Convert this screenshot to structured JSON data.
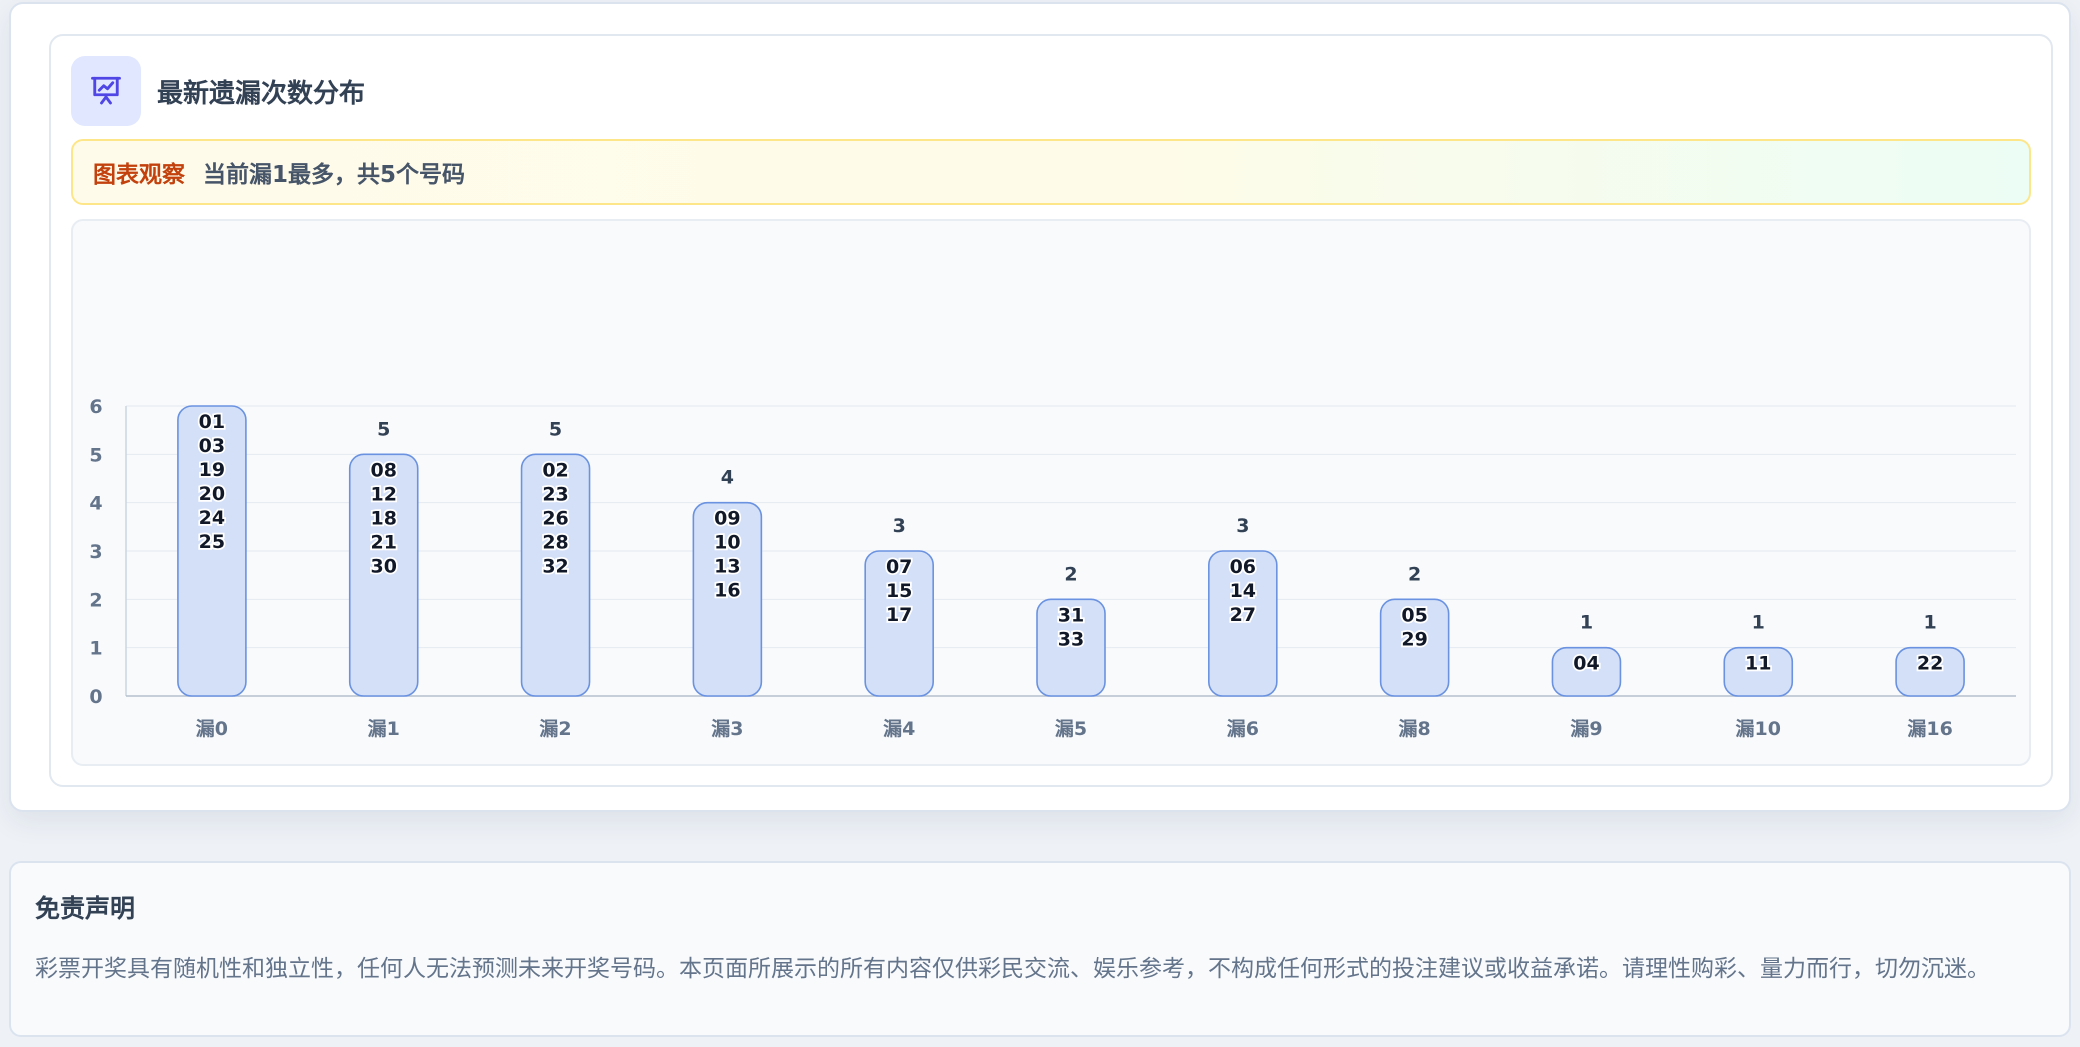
{
  "page": {
    "title": "最新遗漏次数分布",
    "title_icon": "presentation-chart-icon",
    "insight_tag": "图表观察",
    "insight_text": "当前漏1最多，共5个号码"
  },
  "disclaimer": {
    "title": "免责声明",
    "body": "彩票开奖具有随机性和独立性，任何人无法预测未来开奖号码。本页面所展示的所有内容仅供彩民交流、娱乐参考，不构成任何形式的投注建议或收益承诺。请理性购彩、量力而行，切勿沉迷。"
  },
  "colors": {
    "accent": "#4f46e5",
    "bar_fill": "#d3e0f8",
    "bar_stroke": "#6a92e0",
    "insight_tag": "#c2410c"
  },
  "chart_data": {
    "type": "bar",
    "categories": [
      "漏0",
      "漏1",
      "漏2",
      "漏3",
      "漏4",
      "漏5",
      "漏6",
      "漏8",
      "漏9",
      "漏10",
      "漏16"
    ],
    "values": [
      6,
      5,
      5,
      4,
      3,
      2,
      3,
      2,
      1,
      1,
      1
    ],
    "value_labels": [
      "",
      "5",
      "5",
      "4",
      "3",
      "2",
      "3",
      "2",
      "1",
      "1",
      "1"
    ],
    "numbers": [
      [
        "01",
        "03",
        "19",
        "20",
        "24",
        "25"
      ],
      [
        "08",
        "12",
        "18",
        "21",
        "30"
      ],
      [
        "02",
        "23",
        "26",
        "28",
        "32"
      ],
      [
        "09",
        "10",
        "13",
        "16"
      ],
      [
        "07",
        "15",
        "17"
      ],
      [
        "31",
        "33"
      ],
      [
        "06",
        "14",
        "27"
      ],
      [
        "05",
        "29"
      ],
      [
        "04"
      ],
      [
        "11"
      ],
      [
        "22"
      ]
    ],
    "yticks": [
      "0",
      "1",
      "2",
      "3",
      "4",
      "5",
      "6"
    ],
    "ylim": [
      0,
      6
    ],
    "grid": true,
    "title": "",
    "xlabel": "",
    "ylabel": ""
  }
}
